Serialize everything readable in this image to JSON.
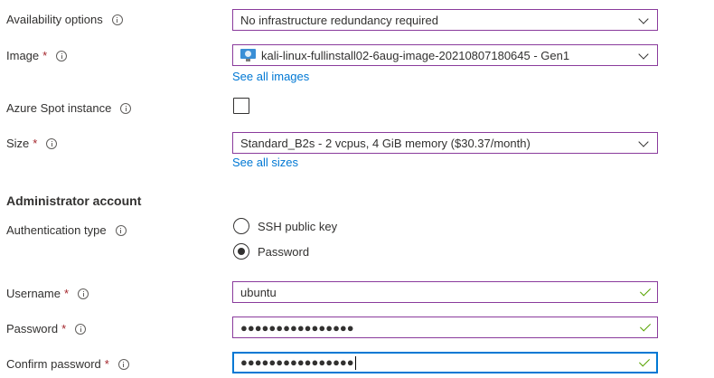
{
  "availability": {
    "label": "Availability options",
    "value": "No infrastructure redundancy required"
  },
  "image": {
    "label": "Image",
    "required_mark": "*",
    "value": "kali-linux-fullinstall02-6aug-image-20210807180645 - Gen1",
    "link": "See all images"
  },
  "spot": {
    "label": "Azure Spot instance",
    "checked": false
  },
  "size": {
    "label": "Size",
    "required_mark": "*",
    "value": "Standard_B2s - 2 vcpus, 4 GiB memory ($30.37/month)",
    "link": "See all sizes"
  },
  "admin": {
    "section_title": "Administrator account",
    "auth_label": "Authentication type",
    "auth_options": [
      {
        "label": "SSH public key",
        "selected": false
      },
      {
        "label": "Password",
        "selected": true
      }
    ],
    "username_label": "Username",
    "username_value": "ubuntu",
    "password_label": "Password",
    "password_value": "●●●●●●●●●●●●●●●●",
    "confirm_label": "Confirm password",
    "confirm_value": "●●●●●●●●●●●●●●●●",
    "required_mark": "*"
  },
  "colors": {
    "field_border": "#8a3b9c",
    "focus_border": "#0078d4",
    "link": "#0078d4",
    "valid_check": "#57a300",
    "required": "#a4262c"
  },
  "icons": {
    "info": "info-icon",
    "dropdown": "chevron-down-icon",
    "valid": "checkmark-icon",
    "image": "vm-image-icon"
  }
}
